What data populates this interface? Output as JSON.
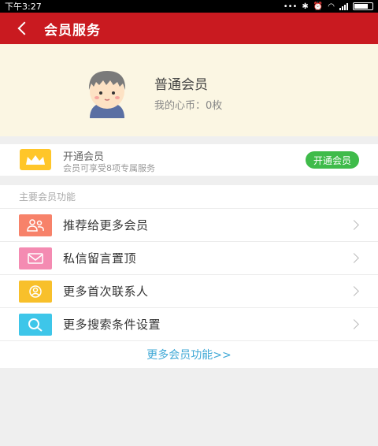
{
  "status_bar": {
    "time": "下午3:27"
  },
  "header": {
    "title": "会员服务"
  },
  "profile": {
    "name": "普通会员",
    "coins": "我的心币：0枚"
  },
  "open_membership": {
    "title": "开通会员",
    "subtitle": "会员可享受8项专属服务",
    "button_label": "开通会员"
  },
  "features": {
    "header": "主要会员功能",
    "items": [
      {
        "label": "推荐给更多会员",
        "icon": "people-icon",
        "color": "#f7826a"
      },
      {
        "label": "私信留言置顶",
        "icon": "envelope-icon",
        "color": "#f48bb2"
      },
      {
        "label": "更多首次联系人",
        "icon": "contact-icon",
        "color": "#f8c02b"
      },
      {
        "label": "更多搜索条件设置",
        "icon": "search-icon",
        "color": "#3ec6e9"
      }
    ],
    "more_link": "更多会员功能>>"
  },
  "colors": {
    "brand_red": "#c91a20",
    "green": "#3fbb4a",
    "link_blue": "#3fa8d6"
  }
}
